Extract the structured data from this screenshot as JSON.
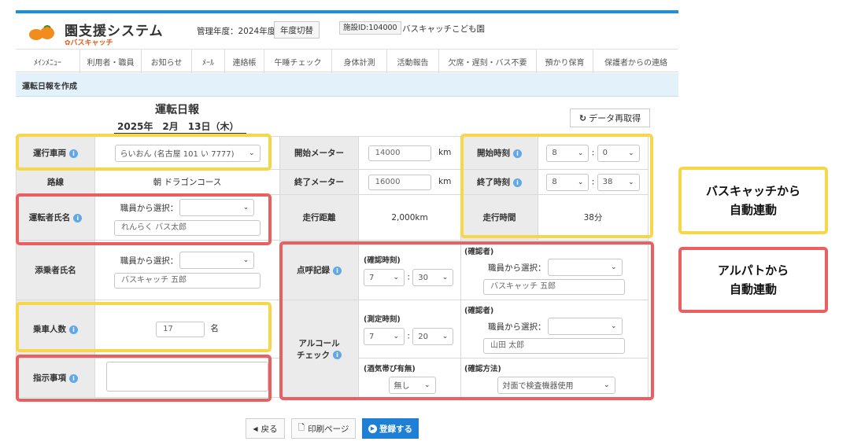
{
  "header": {
    "logo_title": "園支援システム",
    "logo_sub": "✿バスキャッチ",
    "year_label": "管理年度：2024年度",
    "year_switch": "年度切替",
    "facility_id": "施設ID:104000",
    "facility_name": "バスキャッチこども園"
  },
  "nav": {
    "items": [
      "ﾒｲﾝﾒﾆｭｰ",
      "利用者・職員",
      "お知らせ",
      "ﾒｰﾙ",
      "連絡帳",
      "午睡チェック",
      "身体計測",
      "活動報告",
      "欠席・遅刻・バス不要",
      "預かり保育",
      "保護者からの連絡"
    ]
  },
  "subheader": {
    "title": "運転日報を作成"
  },
  "doc": {
    "title": "運転日報",
    "date": "2025年　2月　13日（木）",
    "refetch": "データ再取得",
    "refetch_icon": "refresh-icon"
  },
  "form": {
    "vehicle_label": "運行車両",
    "vehicle_value": "らいおん (名古屋 101 い 7777)",
    "route_label": "路線",
    "route_value": "朝 ドラゴンコース",
    "driver_label": "運転者氏名",
    "staff_select_label": "職員から選択：",
    "driver_name": "れんらく バス太郎",
    "attendant_label": "添乗者氏名",
    "attendant_name": "バスキャッチ 五郎",
    "passengers_label": "乗車人数",
    "passengers_value": "17",
    "passengers_unit": "名",
    "instructions_label": "指示事項",
    "instructions_value": "",
    "start_meter_label": "開始メーター",
    "start_meter_value": "14000",
    "end_meter_label": "終了メーター",
    "end_meter_value": "16000",
    "km_unit": "km",
    "distance_label": "走行距離",
    "distance_value": "2,000km",
    "rollcall_label": "点呼記録",
    "alcohol_label_1": "アルコール",
    "alcohol_label_2": "チェック",
    "start_time_label": "開始時刻",
    "start_hour": "8",
    "start_min": "0",
    "end_time_label": "終了時刻",
    "end_hour": "8",
    "end_min": "38",
    "colon": ":",
    "drive_time_label": "走行時間",
    "drive_time_value": "38分",
    "confirm_time_label": "(確認時刻)",
    "rollcall_hour": "7",
    "rollcall_min": "30",
    "confirmer_label": "(確認者)",
    "rollcall_confirmer": "バスキャッチ 五郎",
    "measure_time_label": "(測定時刻)",
    "alcohol_hour": "7",
    "alcohol_min": "20",
    "alcohol_confirmer": "山田 太郎",
    "drunk_label": "(酒気帯び有無)",
    "drunk_value": "無し",
    "method_label": "(確認方法)",
    "method_value": "対面で検査機器使用"
  },
  "callouts": {
    "buscatch": "バスキャッチから\n自動連動",
    "alpato": "アルパトから\n自動連動"
  },
  "footer": {
    "back": "戻る",
    "print": "印刷ページ",
    "register": "登録する"
  },
  "colors": {
    "accent_blue": "#1e8ee0",
    "highlight_yellow": "#f7d64a",
    "highlight_red": "#ec5f61",
    "logo_orange": "#f28c1c"
  }
}
